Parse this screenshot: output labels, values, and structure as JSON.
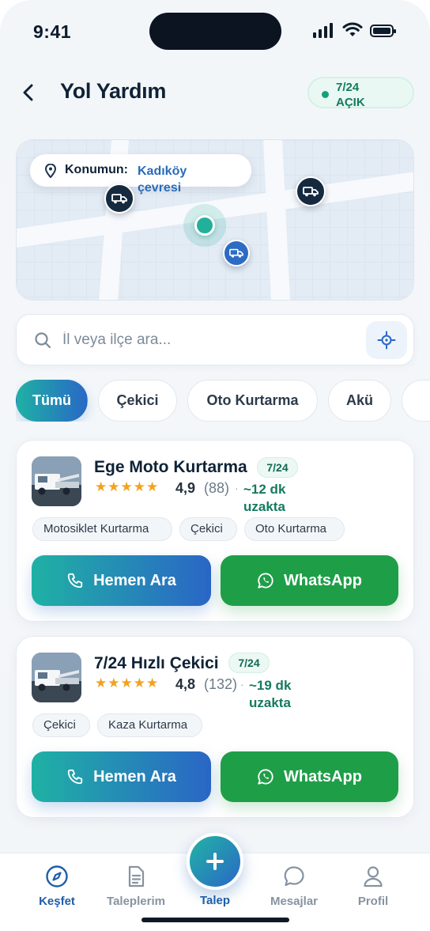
{
  "status_bar": {
    "time": "9:41"
  },
  "header": {
    "title": "Yol Yardım",
    "open_badge": "7/24 AÇIK"
  },
  "map": {
    "location_label": "Konumun:",
    "location_value": "Kadıköy çevresi"
  },
  "search": {
    "placeholder": "İl veya ilçe ara..."
  },
  "filters": [
    {
      "label": "Tümü",
      "active": true
    },
    {
      "label": "Çekici",
      "active": false
    },
    {
      "label": "Oto Kurtarma",
      "active": false
    },
    {
      "label": "Akü",
      "active": false
    }
  ],
  "providers": [
    {
      "name": "Ege Moto Kurtarma",
      "badge": "7/24",
      "stars": "★★★★★",
      "rating": "4,9",
      "reviews": "(88)",
      "distance": "~12 dk uzakta",
      "tags": [
        "Motosiklet Kurtarma",
        "Çekici",
        "Oto Kurtarma"
      ],
      "call_label": "Hemen Ara",
      "whatsapp_label": "WhatsApp"
    },
    {
      "name": "7/24 Hızlı Çekici",
      "badge": "7/24",
      "stars": "★★★★★",
      "rating": "4,8",
      "reviews": "(132)",
      "distance": "~19 dk uzakta",
      "tags": [
        "Çekici",
        "Kaza Kurtarma"
      ],
      "call_label": "Hemen Ara",
      "whatsapp_label": "WhatsApp"
    }
  ],
  "bottom_nav": {
    "items": [
      {
        "label": "Keşfet",
        "icon": "compass-icon",
        "active": true
      },
      {
        "label": "Taleplerim",
        "icon": "document-icon",
        "active": false
      },
      {
        "label": "Talep",
        "icon": "plus-icon",
        "active": false
      },
      {
        "label": "Mesajlar",
        "icon": "chat-bubble-icon",
        "active": false
      },
      {
        "label": "Profil",
        "icon": "user-icon",
        "active": false
      }
    ]
  },
  "colors": {
    "accent_teal": "#1fb1a4",
    "accent_blue": "#2868c6",
    "whatsapp_green": "#1f9e48",
    "open_green": "#137a5e",
    "star": "#f0a321"
  }
}
